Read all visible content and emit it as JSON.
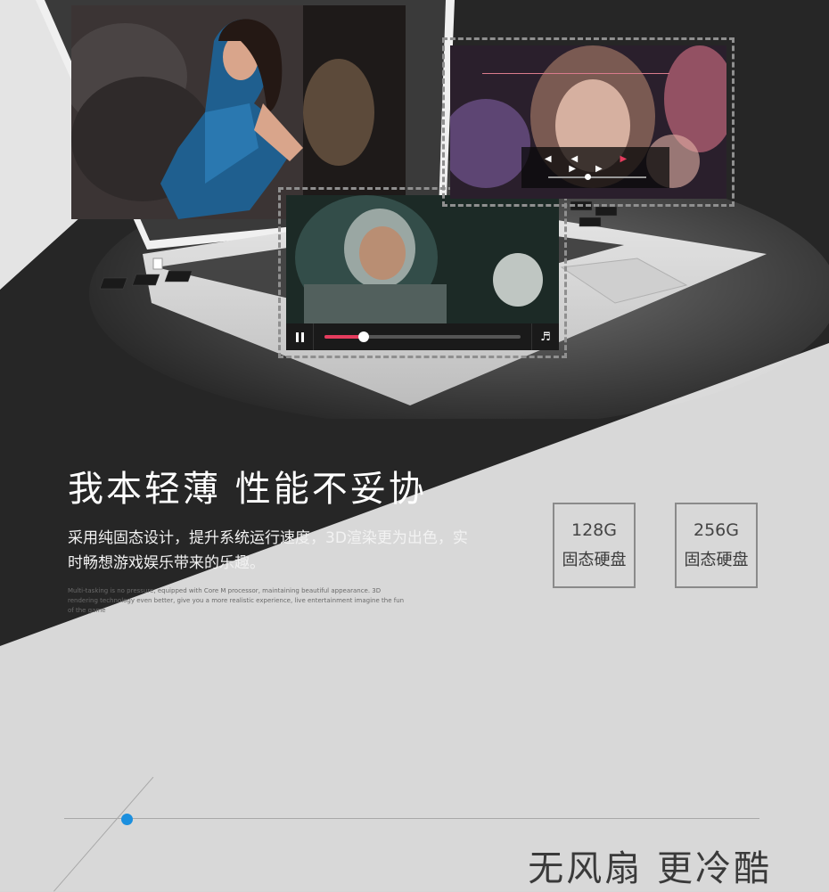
{
  "feature": {
    "headline": "我本轻薄 性能不妥协",
    "description": "采用纯固态设计，提升系统运行速度，3D渲染更为出色，实时畅想游戏娱乐带来的乐趣。",
    "english_note": "Multi-tasking is no pressure, equipped with Core M processor, maintaining beautiful appearance. 3D rendering technology even better, give you a more realistic experience, live entertainment imagine the fun of the game"
  },
  "specs": [
    {
      "capacity": "128G",
      "type": "固态硬盘"
    },
    {
      "capacity": "256G",
      "type": "固态硬盘"
    }
  ],
  "video_player": {
    "progress": 0.2,
    "icons": {
      "pause": "pause-icon",
      "volume": "volume-icon",
      "rewind": "rewind-icon",
      "play": "play-icon",
      "forward": "fast-forward-icon"
    }
  },
  "mini_player": {
    "progress": 0.4
  },
  "next_section": {
    "title": "无风扇 更冷酷"
  },
  "colors": {
    "accent": "#e53c5e",
    "dot": "#1b8fde",
    "dark_band": "#262626",
    "light_bg": "#d6d6d6"
  }
}
